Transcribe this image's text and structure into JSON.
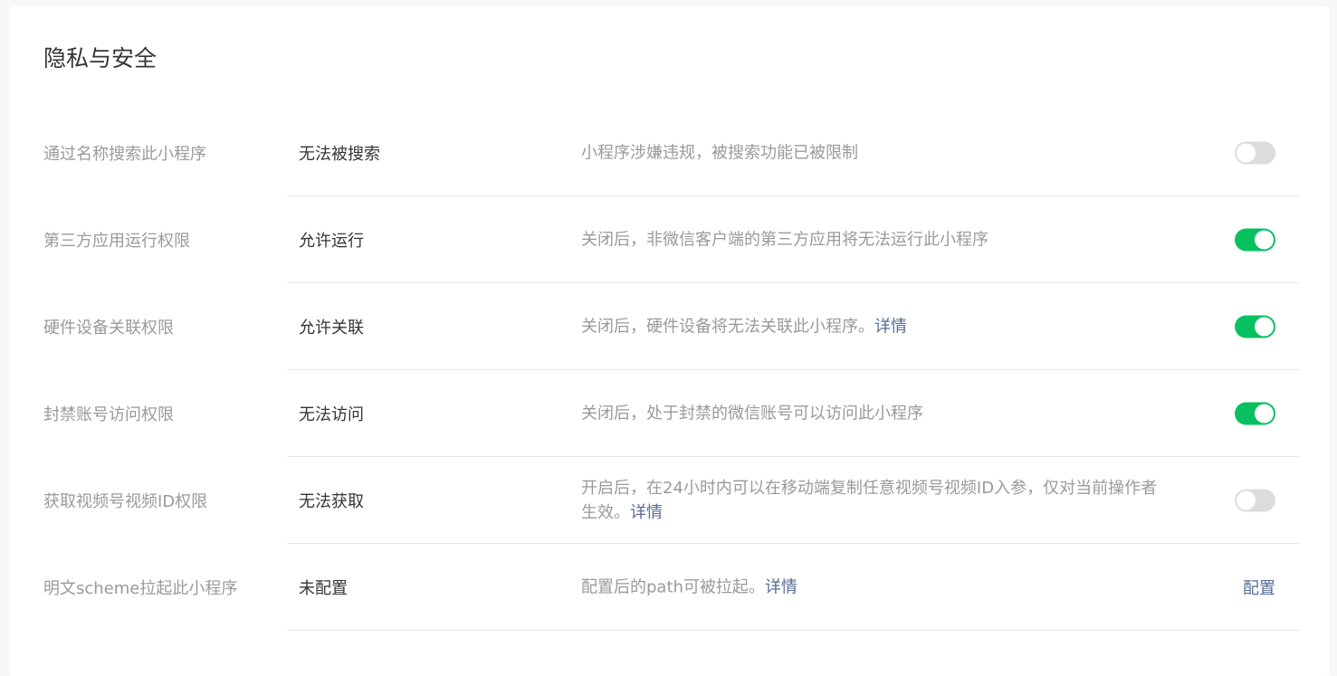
{
  "page": {
    "title": "隐私与安全"
  },
  "colors": {
    "accent_green": "#07c160",
    "toggle_off": "#dcdcdc",
    "link_blue": "#576b95"
  },
  "settings": [
    {
      "label": "通过名称搜索此小程序",
      "value": "无法被搜索",
      "desc": "小程序涉嫌违规，被搜索功能已被限制",
      "link": null,
      "control": "toggle",
      "on": false
    },
    {
      "label": "第三方应用运行权限",
      "value": "允许运行",
      "desc": "关闭后，非微信客户端的第三方应用将无法运行此小程序",
      "link": null,
      "control": "toggle",
      "on": true
    },
    {
      "label": "硬件设备关联权限",
      "value": "允许关联",
      "desc": "关闭后，硬件设备将无法关联此小程序。",
      "link": "详情",
      "control": "toggle",
      "on": true
    },
    {
      "label": "封禁账号访问权限",
      "value": "无法访问",
      "desc": "关闭后，处于封禁的微信账号可以访问此小程序",
      "link": null,
      "control": "toggle",
      "on": true
    },
    {
      "label": "获取视频号视频ID权限",
      "value": "无法获取",
      "desc": "开启后，在24小时内可以在移动端复制任意视频号视频ID入参，仅对当前操作者生效。",
      "link": "详情",
      "control": "toggle",
      "on": false
    },
    {
      "label": "明文scheme拉起此小程序",
      "value": "未配置",
      "desc": "配置后的path可被拉起。",
      "link": "详情",
      "control": "action",
      "action_label": "配置"
    }
  ]
}
